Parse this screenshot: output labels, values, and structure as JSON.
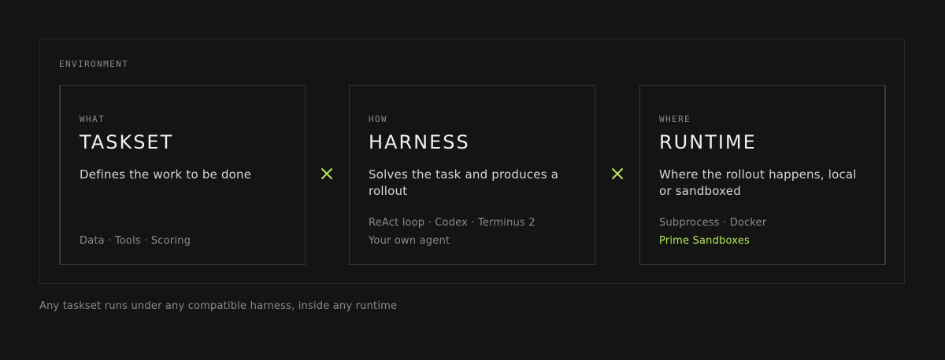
{
  "environment": {
    "label": "ENVIRONMENT"
  },
  "cards": {
    "taskset": {
      "kicker": "WHAT",
      "title": "TASKSET",
      "description": "Defines the work to be done",
      "meta": [
        "Data · Tools · Scoring"
      ]
    },
    "harness": {
      "kicker": "HOW",
      "title": "HARNESS",
      "description": "Solves the task and produces a rollout",
      "meta": [
        "ReAct loop · Codex · Terminus 2",
        "Your own agent"
      ]
    },
    "runtime": {
      "kicker": "WHERE",
      "title": "RUNTIME",
      "description": "Where the rollout happens, local or sandboxed",
      "meta": [
        "Subprocess · Docker",
        "Prime Sandboxes"
      ]
    }
  },
  "operators": {
    "icon": "times-icon",
    "color": "#b6e35a"
  },
  "colors": {
    "accent": "#b6e35a",
    "background": "#141414"
  },
  "footnote": "Any taskset runs under any compatible harness, inside any runtime"
}
